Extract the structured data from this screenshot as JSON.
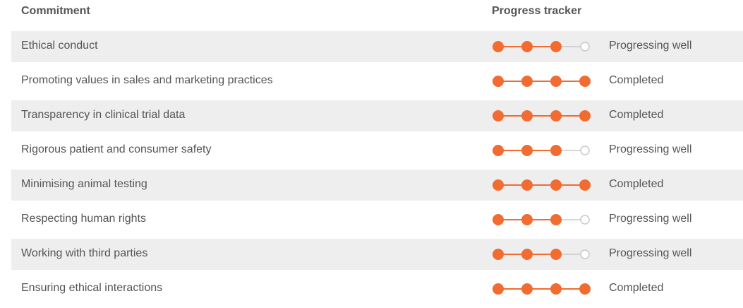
{
  "header": {
    "commitment": "Commitment",
    "progress_tracker": "Progress tracker"
  },
  "colors": {
    "active": "#f26b31",
    "inactive": "#c8c8c8"
  },
  "rows": [
    {
      "commitment": "Ethical conduct",
      "steps_completed": 3,
      "steps_total": 4,
      "status": "Progressing well"
    },
    {
      "commitment": "Promoting values in sales and marketing practices",
      "steps_completed": 4,
      "steps_total": 4,
      "status": "Completed"
    },
    {
      "commitment": "Transparency in clinical trial data",
      "steps_completed": 4,
      "steps_total": 4,
      "status": "Completed"
    },
    {
      "commitment": "Rigorous patient and consumer safety",
      "steps_completed": 3,
      "steps_total": 4,
      "status": "Progressing well"
    },
    {
      "commitment": "Minimising animal testing",
      "steps_completed": 4,
      "steps_total": 4,
      "status": "Completed"
    },
    {
      "commitment": "Respecting human rights",
      "steps_completed": 3,
      "steps_total": 4,
      "status": "Progressing well"
    },
    {
      "commitment": "Working with third parties",
      "steps_completed": 3,
      "steps_total": 4,
      "status": "Progressing well"
    },
    {
      "commitment": "Ensuring ethical interactions",
      "steps_completed": 4,
      "steps_total": 4,
      "status": "Completed"
    }
  ]
}
